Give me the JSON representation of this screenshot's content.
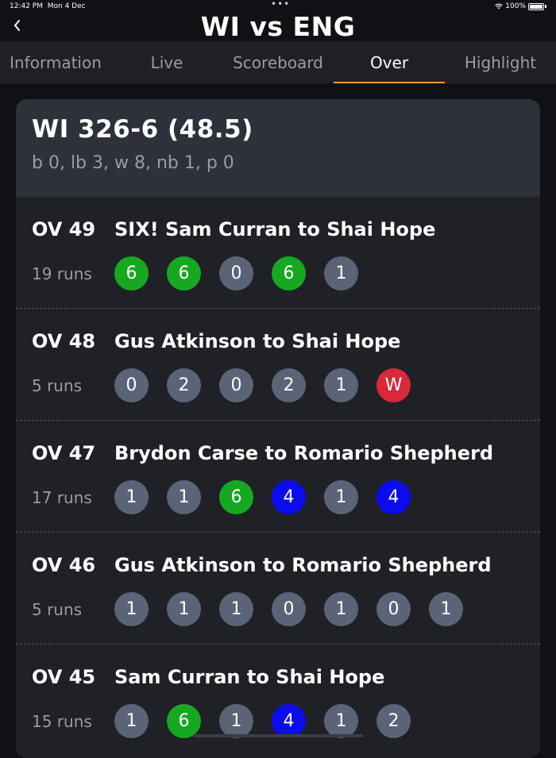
{
  "status": {
    "time": "12:42 PM",
    "date": "Mon 4 Dec",
    "battery": "100%"
  },
  "header": {
    "title": "WI vs ENG"
  },
  "tabs": [
    {
      "label": "Information",
      "active": false
    },
    {
      "label": "Live",
      "active": false
    },
    {
      "label": "Scoreboard",
      "active": false
    },
    {
      "label": "Over",
      "active": true
    },
    {
      "label": "Highlight",
      "active": false
    }
  ],
  "summary": {
    "score": "WI 326-6 (48.5)",
    "extras": "b 0, lb 3, w 8, nb 1, p 0"
  },
  "colors": {
    "six": "#17a822",
    "four": "#0b0bee",
    "wicket": "#d9283a",
    "default_ball": "#5b6476",
    "tab_underline": "#f0a030"
  },
  "overs": [
    {
      "number": "OV 49",
      "description": "SIX! Sam Curran to Shai Hope",
      "runs": "19 runs",
      "balls": [
        "6",
        "6",
        "0",
        "6",
        "1"
      ]
    },
    {
      "number": "OV 48",
      "description": "Gus Atkinson to Shai Hope",
      "runs": "5 runs",
      "balls": [
        "0",
        "2",
        "0",
        "2",
        "1",
        "W"
      ]
    },
    {
      "number": "OV 47",
      "description": "Brydon Carse to Romario Shepherd",
      "runs": "17 runs",
      "balls": [
        "1",
        "1",
        "6",
        "4",
        "1",
        "4"
      ]
    },
    {
      "number": "OV 46",
      "description": "Gus Atkinson to Romario Shepherd",
      "runs": "5 runs",
      "balls": [
        "1",
        "1",
        "1",
        "0",
        "1",
        "0",
        "1"
      ]
    },
    {
      "number": "OV 45",
      "description": "Sam Curran to Shai Hope",
      "runs": "15 runs",
      "balls": [
        "1",
        "6",
        "1",
        "4",
        "1",
        "2"
      ]
    }
  ]
}
